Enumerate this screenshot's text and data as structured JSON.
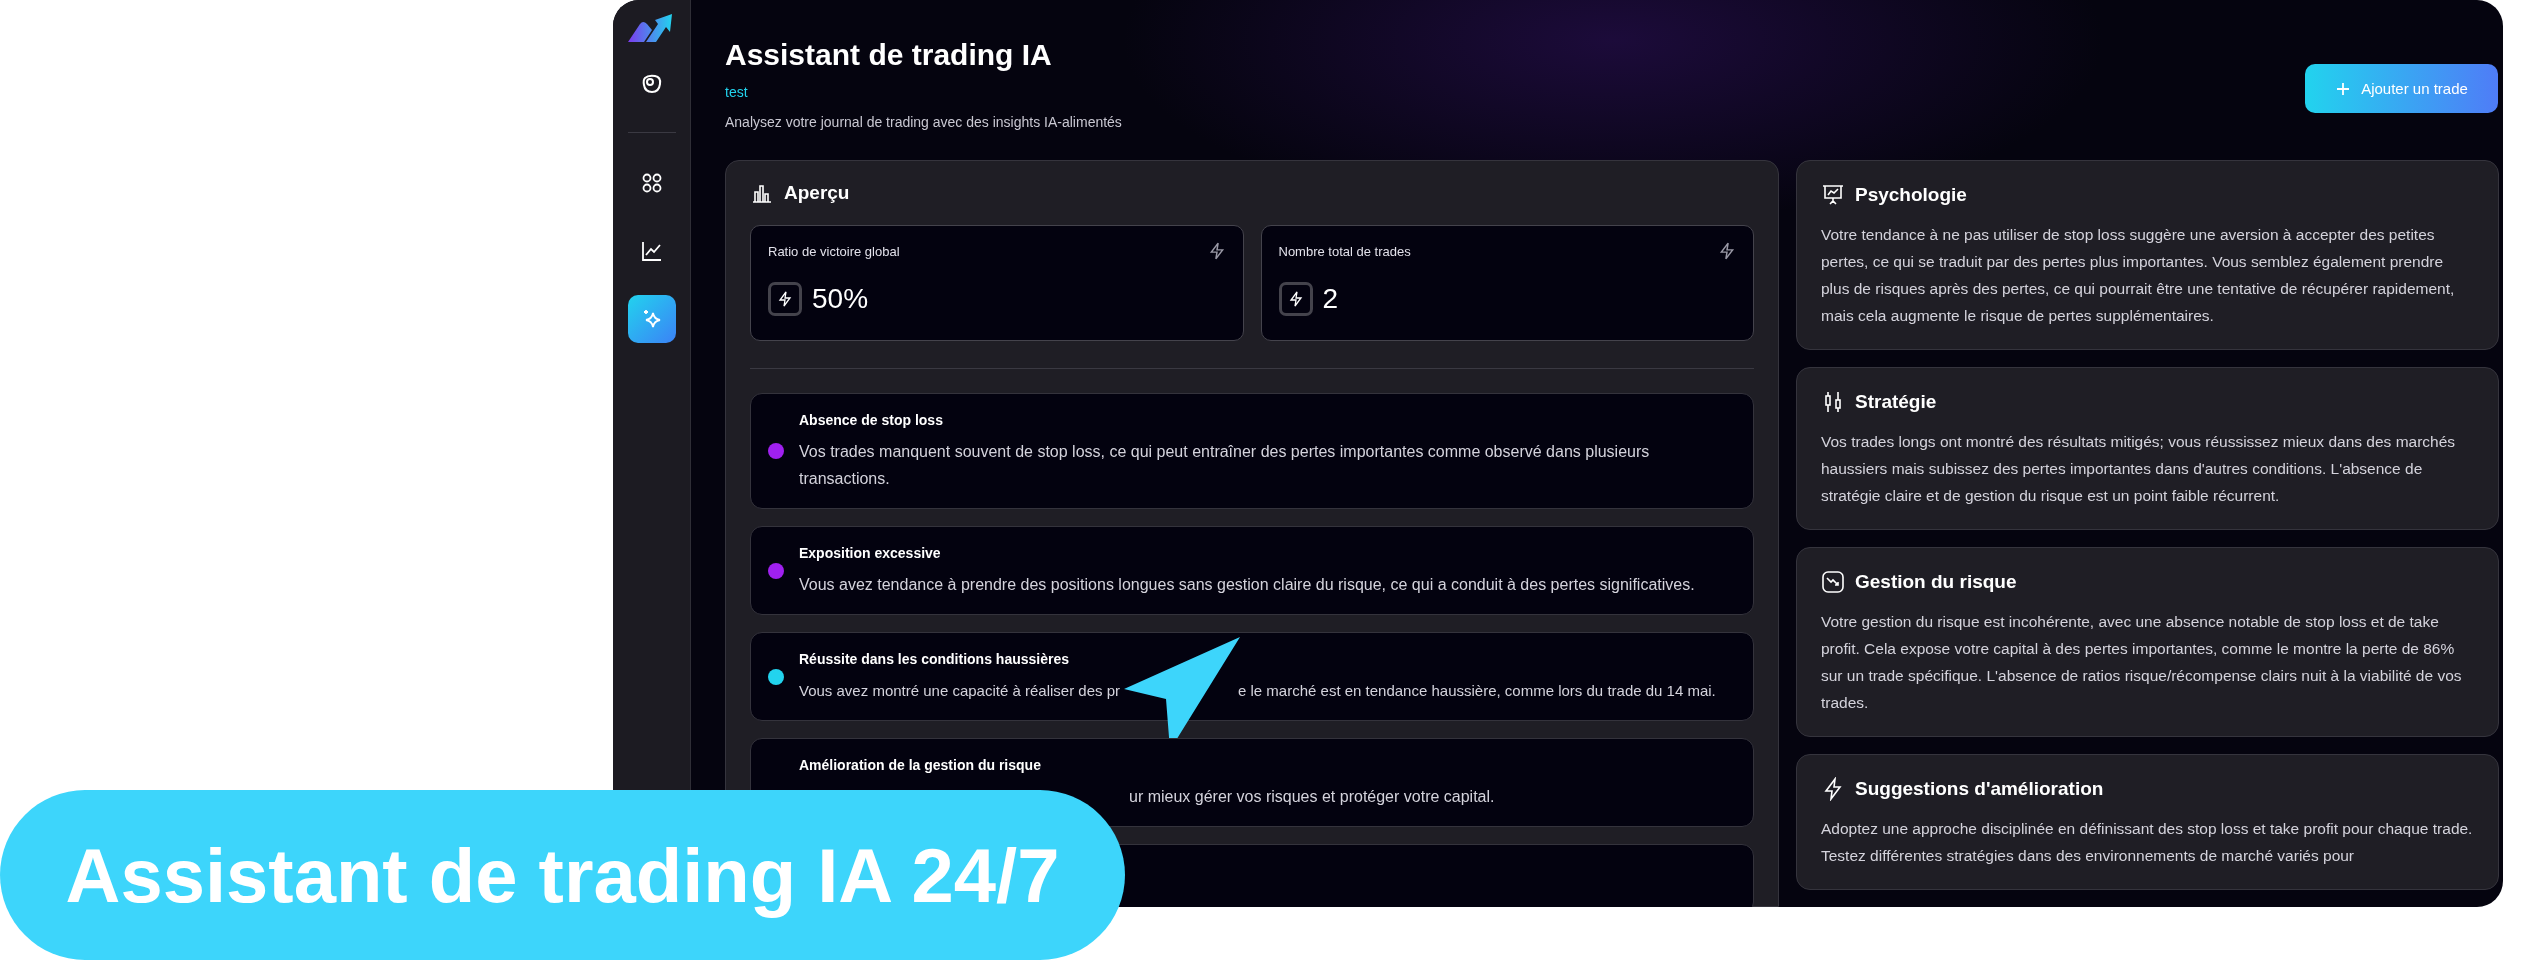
{
  "sidebar": {
    "items": [
      {
        "kind": "profile",
        "selected": false
      },
      {
        "kind": "dashboard",
        "selected": false
      },
      {
        "kind": "chart",
        "selected": false
      },
      {
        "kind": "assistant",
        "selected": true
      }
    ]
  },
  "header": {
    "title": "Assistant de trading IA",
    "tag": "test",
    "subtitle": "Analysez votre journal de trading avec des insights IA-alimentés",
    "add_button": "Ajouter un trade"
  },
  "overview": {
    "title": "Aperçu",
    "stats": [
      {
        "label": "Ratio de victoire global",
        "value": "50%"
      },
      {
        "label": "Nombre total de trades",
        "value": "2"
      }
    ],
    "insights": [
      {
        "title": "Absence de stop loss",
        "color": "#a020f0",
        "description_parts": [
          "Vos trades manquent souvent de stop loss, ce qui peut entraîner des pertes importantes comme observé dans plusieurs transactions."
        ]
      },
      {
        "title": "Exposition excessive",
        "color": "#a020f0",
        "description_parts": [
          "Vous avez tendance à prendre des positions longues sans gestion claire du risque, ce qui a conduit à des pertes significatives."
        ]
      },
      {
        "title": "Réussite dans les conditions haussières",
        "color": "#22d3ee",
        "description_parts": [
          "Vous avez montré une capacité à réaliser des pr",
          "e le marché est en tendance haussière, comme lors du trade du 14 mai."
        ]
      },
      {
        "title": "Amélioration de la gestion du risque",
        "clipped_left": true,
        "description_parts": [
          "ur mieux gérer vos risques et protéger votre capital."
        ]
      }
    ]
  },
  "analysis": [
    {
      "kind": "psychology",
      "title": "Psychologie",
      "text": "Votre tendance à ne pas utiliser de stop loss suggère une aversion à accepter des petites pertes, ce qui se traduit par des pertes plus importantes. Vous semblez également prendre plus de risques après des pertes, ce qui pourrait être une tentative de récupérer rapidement, mais cela augmente le risque de pertes supplémentaires."
    },
    {
      "kind": "strategy",
      "title": "Stratégie",
      "text": "Vos trades longs ont montré des résultats mitigés; vous réussissez mieux dans des marchés haussiers mais subissez des pertes importantes dans d'autres conditions. L'absence de stratégie claire et de gestion du risque est un point faible récurrent."
    },
    {
      "kind": "risk",
      "title": "Gestion du risque",
      "text": "Votre gestion du risque est incohérente, avec une absence notable de stop loss et de take profit. Cela expose votre capital à des pertes importantes, comme le montre la perte de 86% sur un trade spécifique. L'absence de ratios risque/récompense clairs nuit à la viabilité de vos trades."
    },
    {
      "kind": "suggestions",
      "title": "Suggestions d'amélioration",
      "text": "Adoptez une approche disciplinée en définissant des stop loss et take profit pour chaque trade. Testez différentes stratégies dans des environnements de marché variés pour"
    }
  ],
  "banner": {
    "text": "Assistant de trading IA 24/7"
  }
}
